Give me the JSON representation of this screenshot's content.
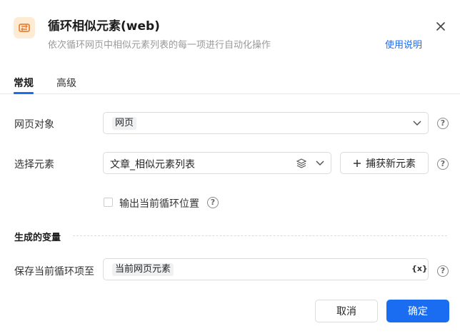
{
  "header": {
    "title": "循环相似元素(web)",
    "subtitle": "依次循环网页中相似元素列表的每一项进行自动化操作",
    "help_link": "使用说明",
    "icon": "loop-icon",
    "close_icon": "close-icon"
  },
  "tabs": [
    {
      "label": "常规",
      "active": true
    },
    {
      "label": "高级",
      "active": false
    }
  ],
  "form": {
    "page_object": {
      "label": "网页对象",
      "value": "网页"
    },
    "select_element": {
      "label": "选择元素",
      "value": "文章_相似元素列表",
      "capture_label": "捕获新元素"
    },
    "output_position": {
      "label": "输出当前循环位置",
      "checked": false
    },
    "section_title": "生成的变量",
    "save_item": {
      "label": "保存当前循环项至",
      "value": "当前网页元素",
      "var_icon": "{x}"
    }
  },
  "footer": {
    "cancel": "取消",
    "ok": "确定"
  },
  "colors": {
    "accent": "#1a6cf0",
    "icon_bg": "#fdebd3",
    "icon_fg": "#e8843a"
  }
}
